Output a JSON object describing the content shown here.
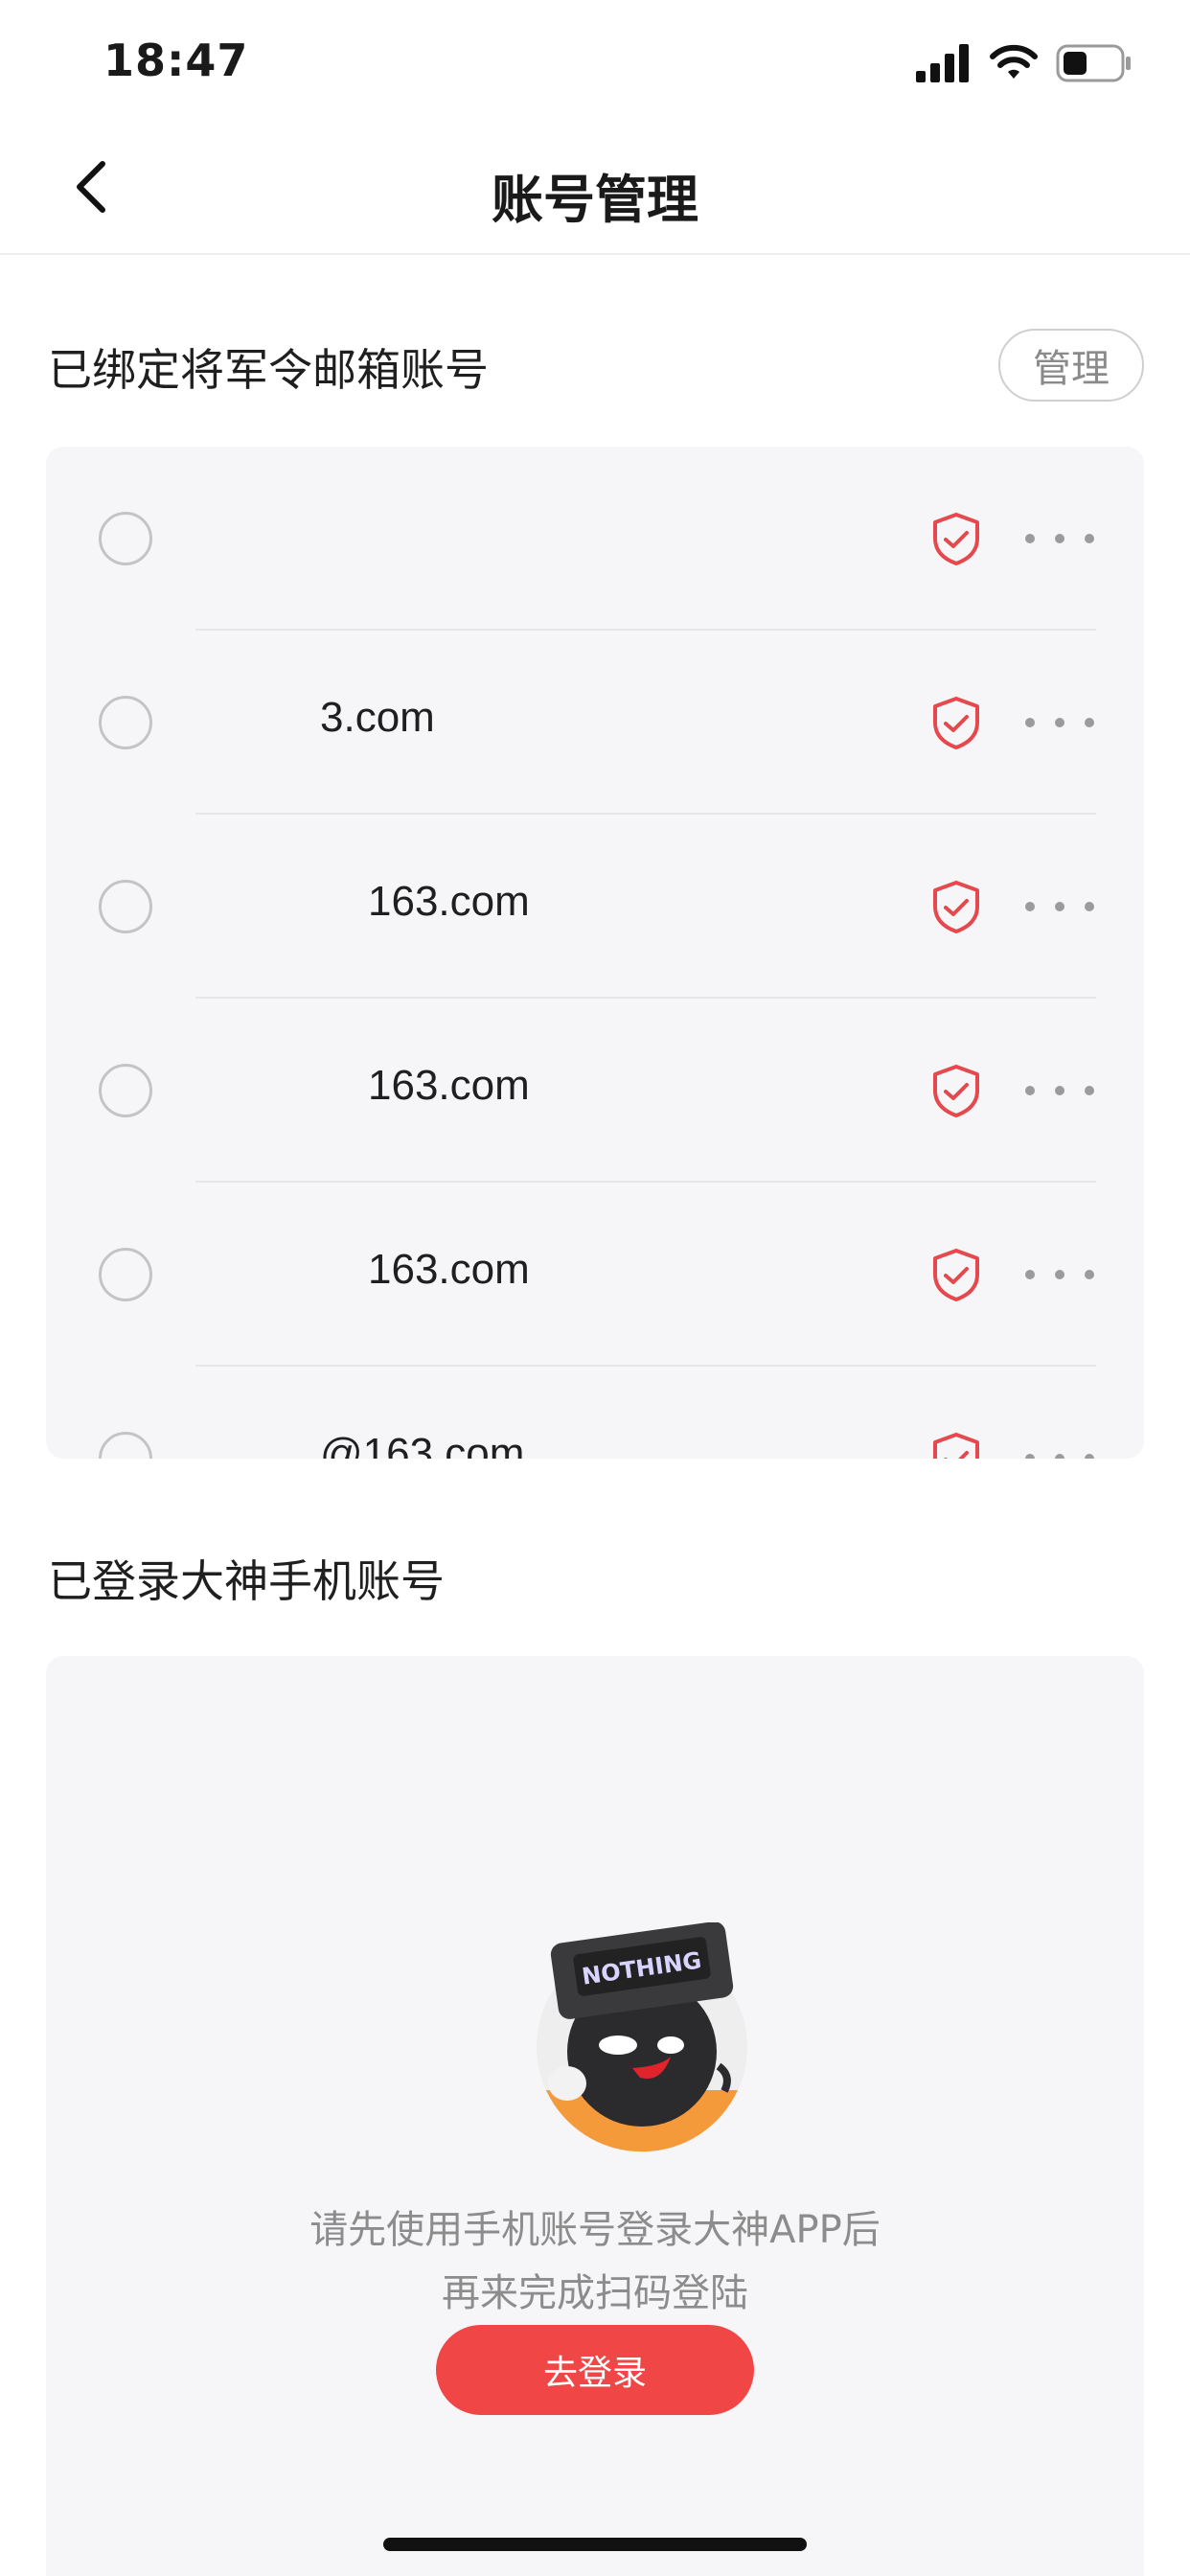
{
  "status_bar": {
    "time": "18:47"
  },
  "nav": {
    "title": "账号管理"
  },
  "bound_section": {
    "title": "已绑定将军令邮箱账号",
    "manage_label": "管理",
    "accounts": [
      {
        "email": "",
        "mask_width": 0
      },
      {
        "email": "3.com",
        "mask_width": 0
      },
      {
        "email": "163.com",
        "mask_width": 0
      },
      {
        "email": "163.com",
        "mask_width": 0
      },
      {
        "email": "163.com",
        "mask_width": 0
      },
      {
        "email": "@163.com",
        "mask_width": 0
      }
    ]
  },
  "phone_section": {
    "title": "已登录大神手机账号",
    "empty_line1": "请先使用手机账号登录大神APP后",
    "empty_line2": "再来完成扫码登陆",
    "login_label": "去登录",
    "mascot_text": "NOTHING"
  },
  "colors": {
    "accent": "#f04646",
    "shield": "#e5484d",
    "card_bg": "#f6f6f8"
  }
}
